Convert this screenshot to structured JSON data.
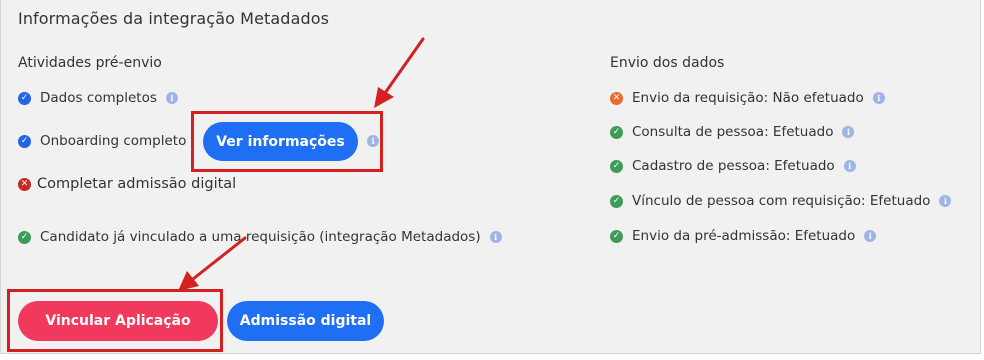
{
  "title": "Informações da integração Metadados",
  "pre_envio": {
    "title": "Atividades pré-envio",
    "items": [
      {
        "label": "Dados completos",
        "status": "ok-blue"
      },
      {
        "label": "Onboarding completo",
        "status": "ok-blue"
      },
      {
        "label": "Completar admissão digital",
        "status": "error"
      },
      {
        "label": "Candidato já vinculado a uma requisição (integração Metadados)",
        "status": "ok-green"
      }
    ],
    "ver_informacoes_button": "Ver informações"
  },
  "envio": {
    "title": "Envio dos dados",
    "items": [
      {
        "label": "Envio da requisição: Não efetuado",
        "status": "pending"
      },
      {
        "label": "Consulta de pessoa: Efetuado",
        "status": "ok"
      },
      {
        "label": "Cadastro de pessoa: Efetuado",
        "status": "ok"
      },
      {
        "label": "Vínculo de pessoa com requisição: Efetuado",
        "status": "ok"
      },
      {
        "label": "Envio da pré-admissão: Efetuado",
        "status": "ok"
      }
    ]
  },
  "buttons": {
    "vincular": "Vincular Aplicação",
    "admissao": "Admissão digital"
  },
  "colors": {
    "primary_button": "#1e6ff3",
    "accent_button": "#f0395c",
    "check_blue": "#2563eb",
    "check_green": "#3f9c58",
    "error_red": "#c62828",
    "pending_orange": "#ee6a2c",
    "highlight_red": "#d42020"
  }
}
